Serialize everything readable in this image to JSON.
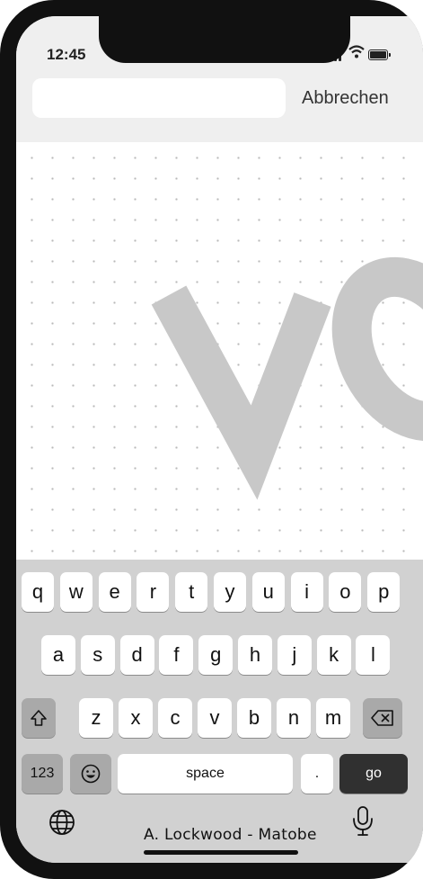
{
  "status_bar": {
    "time": "12:45",
    "icons": [
      "signal-icon",
      "wifi-icon",
      "battery-icon"
    ]
  },
  "search": {
    "value": "",
    "placeholder": "",
    "cancel_label": "Abbrechen"
  },
  "watermark": {
    "text": "VO",
    "color": "#c8c8c8"
  },
  "keyboard": {
    "row1": [
      "q",
      "w",
      "e",
      "r",
      "t",
      "y",
      "u",
      "i",
      "o",
      "p"
    ],
    "row2": [
      "a",
      "s",
      "d",
      "f",
      "g",
      "h",
      "j",
      "k",
      "l"
    ],
    "row3_letters": [
      "z",
      "x",
      "c",
      "v",
      "b",
      "n",
      "m"
    ],
    "shift_icon": "shift-icon",
    "delete_icon": "delete-icon",
    "numbers_label": "123",
    "emoji_icon": "emoji-icon",
    "space_label": "space",
    "period_label": ".",
    "go_label": "go",
    "globe_icon": "globe-icon",
    "mic_icon": "mic-icon"
  },
  "footer": {
    "signature": "A. Lockwood - Matobe"
  },
  "colors": {
    "keyboard_bg": "#d1d1d1",
    "key_bg": "#ffffff",
    "special_key_bg": "#a9a9a9",
    "go_key_bg": "#303030",
    "phone_frame": "#111111"
  }
}
